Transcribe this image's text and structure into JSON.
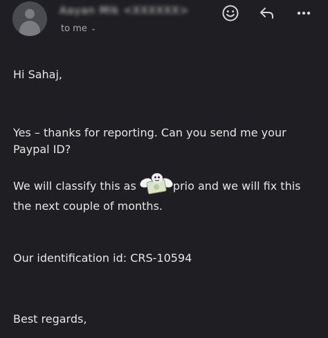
{
  "header": {
    "sender_name": "Aayan Mlk <XXXXXX>",
    "recipient_label": "to me",
    "recipient_chevron": "chevron-down-icon"
  },
  "toolbar": {
    "emoji_icon": "smiley-face-icon",
    "reply_icon": "reply-arrow-icon",
    "more_icon": "more-horizontal-icon"
  },
  "message": {
    "greeting": "Hi Sahaj,",
    "para1_line1": "Yes – thanks for reporting. Can you send me your",
    "para1_line2": "Paypal ID?",
    "para2_line1_before": "We will classify this as ",
    "para2_line1_after": "prio and we will fix this",
    "para2_line2": "the next couple of months.",
    "identification": "Our identification id: CRS-10594",
    "closing": "Best regards,"
  },
  "colors": {
    "background": "#1f1f23",
    "text": "#e6e6e6",
    "muted": "#a9aab0"
  }
}
